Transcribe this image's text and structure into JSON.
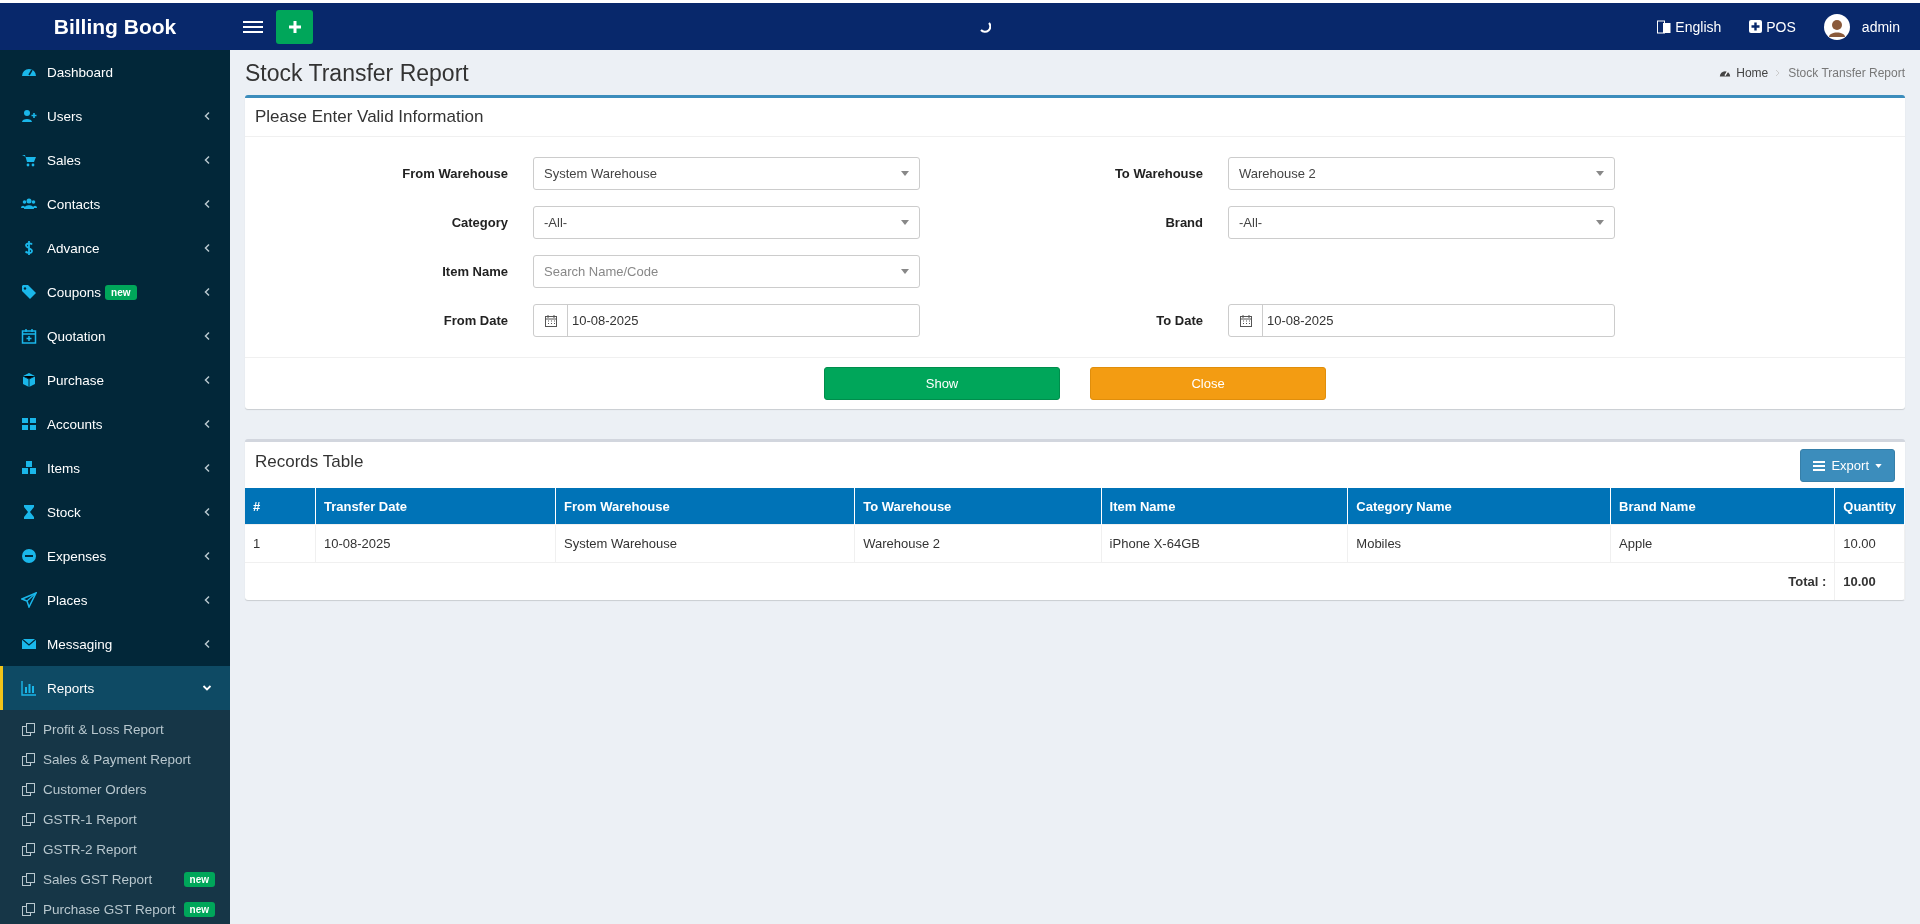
{
  "header": {
    "brand": "Billing Book",
    "language": "English",
    "pos": "POS",
    "user": "admin"
  },
  "sidebar": {
    "items": [
      {
        "label": "Dashboard",
        "kind": "link",
        "selected": false
      },
      {
        "label": "Users",
        "kind": "menu",
        "expanded": false,
        "selected": false
      },
      {
        "label": "Sales",
        "kind": "menu",
        "expanded": false,
        "selected": false
      },
      {
        "label": "Contacts",
        "kind": "menu",
        "expanded": false,
        "selected": false
      },
      {
        "label": "Advance",
        "kind": "menu",
        "expanded": false,
        "selected": false
      },
      {
        "label": "Coupons",
        "badge": "new",
        "kind": "menu",
        "expanded": false,
        "selected": false
      },
      {
        "label": "Quotation",
        "kind": "menu",
        "expanded": false,
        "selected": false
      },
      {
        "label": "Purchase",
        "kind": "menu",
        "expanded": false,
        "selected": false
      },
      {
        "label": "Accounts",
        "kind": "menu",
        "expanded": false,
        "selected": false
      },
      {
        "label": "Items",
        "kind": "menu",
        "expanded": false,
        "selected": false
      },
      {
        "label": "Stock",
        "kind": "menu",
        "expanded": false,
        "selected": false
      },
      {
        "label": "Expenses",
        "kind": "menu",
        "expanded": false,
        "selected": false
      },
      {
        "label": "Places",
        "kind": "menu",
        "expanded": false,
        "selected": false
      },
      {
        "label": "Messaging",
        "kind": "menu",
        "expanded": false,
        "selected": false
      },
      {
        "label": "Reports",
        "kind": "menu",
        "expanded": true,
        "selected": true,
        "children": [
          {
            "label": "Profit & Loss Report"
          },
          {
            "label": "Sales & Payment Report"
          },
          {
            "label": "Customer Orders"
          },
          {
            "label": "GSTR-1 Report"
          },
          {
            "label": "GSTR-2 Report"
          },
          {
            "label": "Sales GST Report",
            "badge": "new"
          },
          {
            "label": "Purchase GST Report",
            "badge": "new"
          }
        ]
      }
    ]
  },
  "page": {
    "title": "Stock Transfer Report",
    "breadcrumb": [
      "Home",
      "Stock Transfer Report"
    ]
  },
  "form": {
    "title": "Please Enter Valid Information",
    "rows": [
      [
        {
          "label": "From Warehouse",
          "kind": "select",
          "value": "System Warehouse"
        },
        {
          "label": "To Warehouse",
          "kind": "select",
          "value": "Warehouse 2"
        }
      ],
      [
        {
          "label": "Category",
          "kind": "select",
          "value": "-All-"
        },
        {
          "label": "Brand",
          "kind": "select",
          "value": "-All-"
        }
      ],
      [
        {
          "label": "Item Name",
          "kind": "select",
          "placeholder": "Search Name/Code"
        }
      ],
      [
        {
          "label": "From Date",
          "kind": "date",
          "value": "10-08-2025"
        },
        {
          "label": "To Date",
          "kind": "date",
          "value": "10-08-2025"
        }
      ]
    ],
    "buttons": [
      {
        "label": "Show",
        "kind": "primary"
      },
      {
        "label": "Close",
        "kind": "warning"
      }
    ]
  },
  "records": {
    "title": "Records Table",
    "export": "Export",
    "columns": [
      "#",
      "Transfer Date",
      "From Warehouse",
      "To Warehouse",
      "Item Name",
      "Category Name",
      "Brand Name",
      "Quantity"
    ],
    "rows": [
      [
        "1",
        "10-08-2025",
        "System Warehouse",
        "Warehouse 2",
        "iPhone X-64GB",
        "Mobiles",
        "Apple",
        "10.00"
      ]
    ],
    "total_label": "Total :",
    "total": "10.00"
  }
}
